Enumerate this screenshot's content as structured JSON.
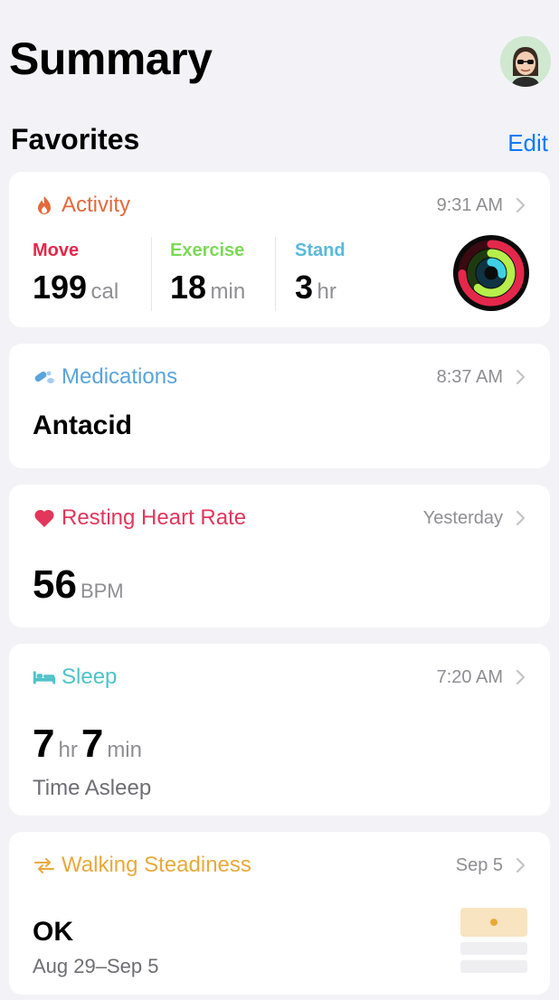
{
  "header": {
    "title": "Summary",
    "avatar_icon": "memoji-avatar-icon"
  },
  "favorites": {
    "title": "Favorites",
    "edit_label": "Edit"
  },
  "cards": {
    "activity": {
      "title": "Activity",
      "time": "9:31 AM",
      "color": "#e5693b",
      "move": {
        "label": "Move",
        "value": "199",
        "unit": "cal",
        "color": "#e4284b"
      },
      "exercise": {
        "label": "Exercise",
        "value": "18",
        "unit": "min",
        "color": "#7cd957"
      },
      "stand": {
        "label": "Stand",
        "value": "3",
        "unit": "hr",
        "color": "#5ab9dc"
      }
    },
    "medications": {
      "title": "Medications",
      "time": "8:37 AM",
      "value": "Antacid",
      "color": "#5aa3dc"
    },
    "heart": {
      "title": "Resting Heart Rate",
      "time": "Yesterday",
      "value": "56",
      "unit": "BPM",
      "color": "#e2365b"
    },
    "sleep": {
      "title": "Sleep",
      "time": "7:20 AM",
      "hours": "7",
      "hours_unit": "hr",
      "minutes": "7",
      "minutes_unit": "min",
      "caption": "Time Asleep",
      "color": "#4fc3c9"
    },
    "steadiness": {
      "title": "Walking Steadiness",
      "time": "Sep 5",
      "value": "OK",
      "range": "Aug 29–Sep 5",
      "color": "#e9a93a"
    }
  }
}
